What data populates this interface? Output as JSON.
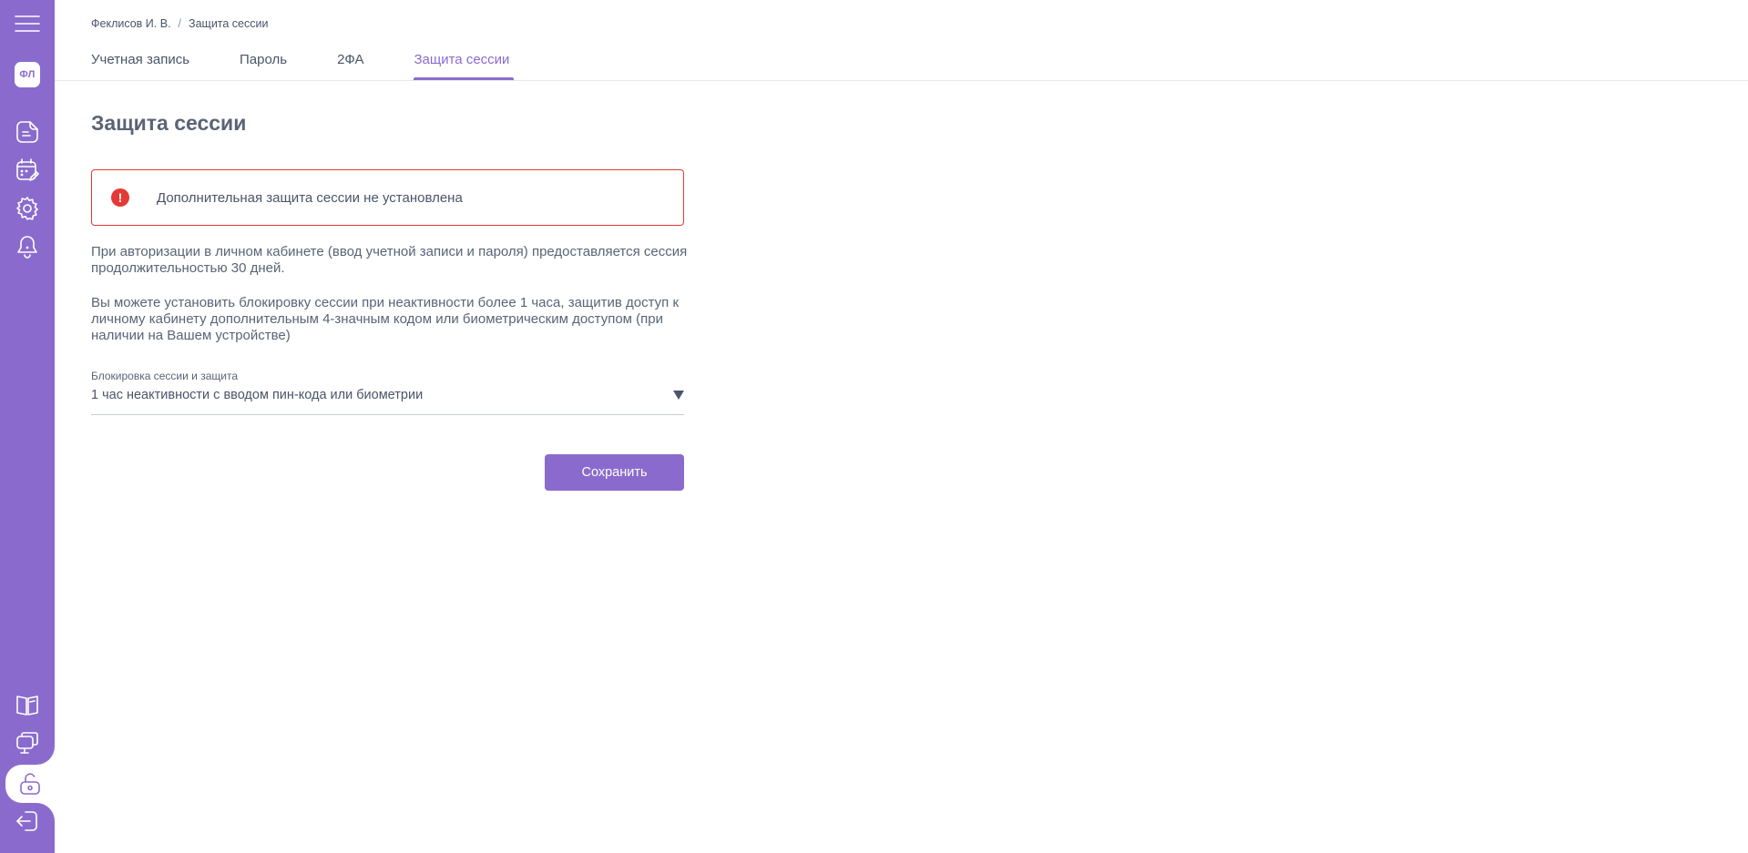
{
  "sidebar": {
    "avatar_initials": "ФЛ",
    "accent_color": "#8a6bcd",
    "top_icons": [
      "menu-icon",
      "document-icon",
      "calendar-edit-icon",
      "gear-icon",
      "bell-icon"
    ],
    "bottom_icons": [
      "book-icon",
      "monitor-icon",
      "lock-icon",
      "exit-icon"
    ],
    "active_item": "lock-icon"
  },
  "breadcrumb": {
    "user": "Феклисов И. В.",
    "separator": "/",
    "current": "Защита сессии"
  },
  "tabs": [
    {
      "label": "Учетная запись",
      "active": false
    },
    {
      "label": "Пароль",
      "active": false
    },
    {
      "label": "2ФА",
      "active": false
    },
    {
      "label": "Защита сессии",
      "active": true
    }
  ],
  "main": {
    "title": "Защита сессии",
    "alert": {
      "icon": "!",
      "text": "Дополнительная защита сессии не установлена",
      "color": "#e53935"
    },
    "paragraph1": "При авторизации в личном кабинете (ввод учетной записи и пароля) предоставляется сессия продолжительностью 30 дней.",
    "paragraph2": "Вы можете установить блокировку сессии при неактивности более 1 часа, защитив доступ к личному кабинету дополнительным 4-значным кодом или биометрическим доступом (при наличии на Вашем устройстве)",
    "select": {
      "label": "Блокировка сессии и защита",
      "value": "1 час неактивности с вводом пин-кода или биометрии"
    },
    "save_label": "Сохранить"
  }
}
